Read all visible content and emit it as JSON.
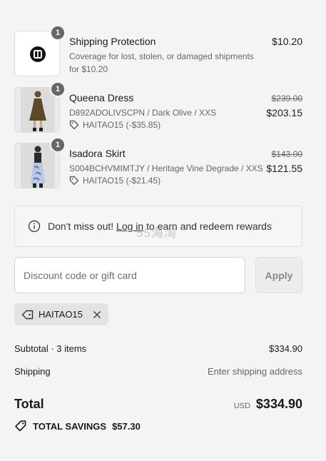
{
  "items": [
    {
      "qty": "1",
      "title": "Shipping Protection",
      "subtitle": "Coverage for lost, stolen, or damaged shipments for $10.20",
      "price": "$10.20"
    },
    {
      "qty": "1",
      "title": "Queena Dress",
      "subtitle": "D892ADOLIVSCPN / Dark Olive / XXS",
      "discount": "HAITAO15 (-$35.85)",
      "original_price": "$239.00",
      "price": "$203.15"
    },
    {
      "qty": "1",
      "title": "Isadora Skirt",
      "subtitle": "S004BCHVMIMTJY / Heritage Vine Degrade / XXS",
      "discount": "HAITAO15 (-$21.45)",
      "original_price": "$143.00",
      "price": "$121.55"
    }
  ],
  "notice": {
    "prefix": "Don't miss out!",
    "link": "Log in",
    "suffix": "to earn and redeem rewards"
  },
  "watermark": "55海淘",
  "discount_field": {
    "placeholder": "Discount code or gift card",
    "apply_label": "Apply"
  },
  "applied_code": "HAITAO15",
  "summary": {
    "subtotal_label": "Subtotal · 3 items",
    "subtotal_value": "$334.90",
    "shipping_label": "Shipping",
    "shipping_value": "Enter shipping address",
    "total_label": "Total",
    "currency": "USD",
    "total_value": "$334.90",
    "savings_label": "TOTAL SAVINGS",
    "savings_value": "$57.30"
  },
  "colors": {
    "background": "#f4f4f4",
    "badge": "#666666",
    "muted_text": "#666666"
  }
}
